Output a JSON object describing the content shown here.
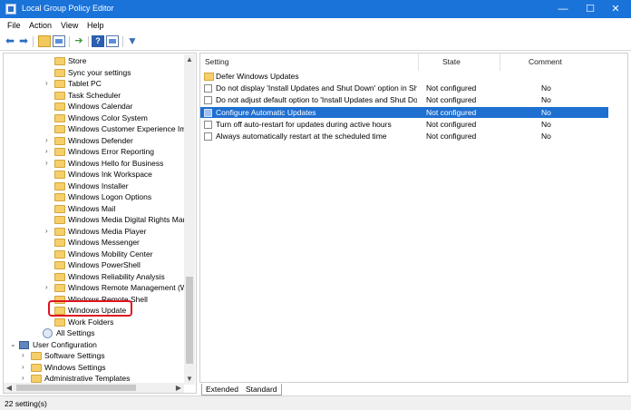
{
  "window": {
    "title": "Local Group Policy Editor",
    "minimize": "—",
    "maximize": "☐",
    "close": "✕"
  },
  "menu": {
    "file": "File",
    "action": "Action",
    "view": "View",
    "help": "Help"
  },
  "toolbar": {
    "back": "⬅",
    "forward": "➡",
    "help": "?",
    "filter": "▼"
  },
  "tree": {
    "items": [
      {
        "label": "Store",
        "icon": "folder-icon",
        "expandable": false
      },
      {
        "label": "Sync your settings",
        "icon": "folder-icon",
        "expandable": false
      },
      {
        "label": "Tablet PC",
        "icon": "folder-icon",
        "expandable": true
      },
      {
        "label": "Task Scheduler",
        "icon": "folder-icon",
        "expandable": false
      },
      {
        "label": "Windows Calendar",
        "icon": "folder-icon",
        "expandable": false
      },
      {
        "label": "Windows Color System",
        "icon": "folder-icon",
        "expandable": false
      },
      {
        "label": "Windows Customer Experience Imp",
        "icon": "folder-icon",
        "expandable": false
      },
      {
        "label": "Windows Defender",
        "icon": "folder-icon",
        "expandable": true
      },
      {
        "label": "Windows Error Reporting",
        "icon": "folder-icon",
        "expandable": true
      },
      {
        "label": "Windows Hello for Business",
        "icon": "folder-icon",
        "expandable": true
      },
      {
        "label": "Windows Ink Workspace",
        "icon": "folder-icon",
        "expandable": false
      },
      {
        "label": "Windows Installer",
        "icon": "folder-icon",
        "expandable": false
      },
      {
        "label": "Windows Logon Options",
        "icon": "folder-icon",
        "expandable": false
      },
      {
        "label": "Windows Mail",
        "icon": "folder-icon",
        "expandable": false
      },
      {
        "label": "Windows Media Digital Rights Mana",
        "icon": "folder-icon",
        "expandable": false
      },
      {
        "label": "Windows Media Player",
        "icon": "folder-icon",
        "expandable": true
      },
      {
        "label": "Windows Messenger",
        "icon": "folder-icon",
        "expandable": false
      },
      {
        "label": "Windows Mobility Center",
        "icon": "folder-icon",
        "expandable": false
      },
      {
        "label": "Windows PowerShell",
        "icon": "folder-icon",
        "expandable": false
      },
      {
        "label": "Windows Reliability Analysis",
        "icon": "folder-icon",
        "expandable": false
      },
      {
        "label": "Windows Remote Management (Wi",
        "icon": "folder-icon",
        "expandable": true
      },
      {
        "label": "Windows Remote Shell",
        "icon": "folder-icon",
        "expandable": false
      },
      {
        "label": "Windows Update",
        "icon": "folder-icon",
        "expandable": false,
        "highlighted": true
      },
      {
        "label": "Work Folders",
        "icon": "folder-icon",
        "expandable": false
      },
      {
        "label": "All Settings",
        "icon": "settings-icon",
        "expandable": false
      },
      {
        "label": "User Configuration",
        "icon": "computer-icon",
        "expandable": true,
        "expanded": true
      },
      {
        "label": "Software Settings",
        "icon": "folder-icon",
        "expandable": true
      },
      {
        "label": "Windows Settings",
        "icon": "folder-icon",
        "expandable": true
      },
      {
        "label": "Administrative Templates",
        "icon": "folder-icon",
        "expandable": true
      }
    ]
  },
  "list": {
    "columns": {
      "setting": "Setting",
      "state": "State",
      "comment": "Comment"
    },
    "rows": [
      {
        "setting": "Defer Windows Updates",
        "state": "",
        "comment": "",
        "icon": "folder-icon"
      },
      {
        "setting": "Do not display 'Install Updates and Shut Down' option in Sh...",
        "state": "Not configured",
        "comment": "No",
        "icon": "policy-icon"
      },
      {
        "setting": "Do not adjust default option to 'Install Updates and Shut Do...",
        "state": "Not configured",
        "comment": "No",
        "icon": "policy-icon"
      },
      {
        "setting": "Configure Automatic Updates",
        "state": "Not configured",
        "comment": "No",
        "icon": "policy-icon",
        "selected": true
      },
      {
        "setting": "Turn off auto-restart for updates during active hours",
        "state": "Not configured",
        "comment": "No",
        "icon": "policy-icon"
      },
      {
        "setting": "Always automatically restart at the scheduled time",
        "state": "Not configured",
        "comment": "No",
        "icon": "policy-icon"
      }
    ]
  },
  "tabs": {
    "extended": "Extended",
    "standard": "Standard"
  },
  "status": {
    "text": "22 setting(s)"
  },
  "colors": {
    "titlebar": "#1a73d9",
    "selection": "#1e6fd0",
    "highlight_ring": "#e0141e"
  }
}
